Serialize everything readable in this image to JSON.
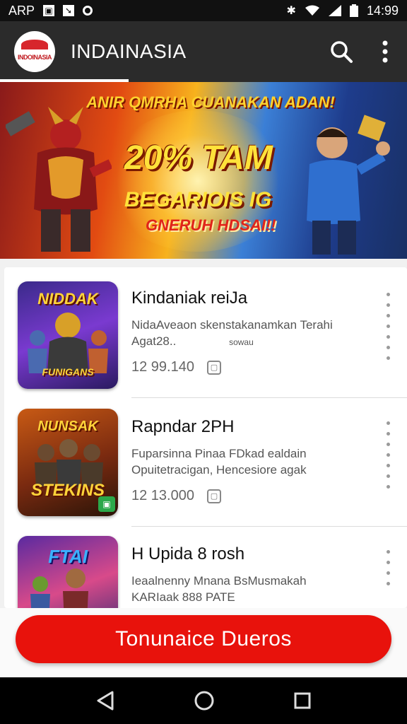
{
  "status_bar": {
    "left_label": "ARP",
    "time": "14:99",
    "icons": [
      "image-icon",
      "notification-icon",
      "record-icon",
      "bluetooth-icon",
      "wifi-icon",
      "signal-icon",
      "battery-icon"
    ]
  },
  "app_bar": {
    "logo_text": "INDOINASIA",
    "title": "INDAINASIA",
    "icons": [
      "search-icon",
      "more-vert-icon"
    ]
  },
  "banner": {
    "headline": "ANIR QMRHA CUANAKAN ADAN!",
    "promo_line1": "20% TAM",
    "promo_line2": "BEGARIOIS IG",
    "promo_line3": "GNERUH HDSAI!!"
  },
  "list": {
    "items": [
      {
        "thumb_title": "NIDDAK",
        "thumb_subtitle": "FUNIGANS",
        "title": "Kindaniak reiJa",
        "description_line1": "NidaAveaon skenstakanamkan Terahi",
        "description_line2": "Agat28..",
        "description_extra": "sowau",
        "meta": "12 99.140"
      },
      {
        "thumb_title": "NUNSAK",
        "thumb_subtitle": "STEKINS",
        "title": "Rapndar 2PH",
        "description_line1": "Fuparsinna Pinaa FDkad ealdain",
        "description_line2": "Opuitetracigan, Hencesiore agak",
        "meta": "12 13.000"
      },
      {
        "thumb_title": "FTAI",
        "title": "H Upida 8 rosh",
        "description_line1": "Ieaalnenny Mnana BsMusmakah",
        "description_line2": "KARIaak 888 PATE"
      }
    ]
  },
  "cta": {
    "label": "Tonunaice Dueros"
  },
  "nav_bar": {
    "icons": [
      "back-icon",
      "home-icon",
      "recents-icon"
    ]
  },
  "colors": {
    "accent": "#e8120c",
    "app_bar": "#2b2b2b",
    "status_bar": "#111111"
  }
}
